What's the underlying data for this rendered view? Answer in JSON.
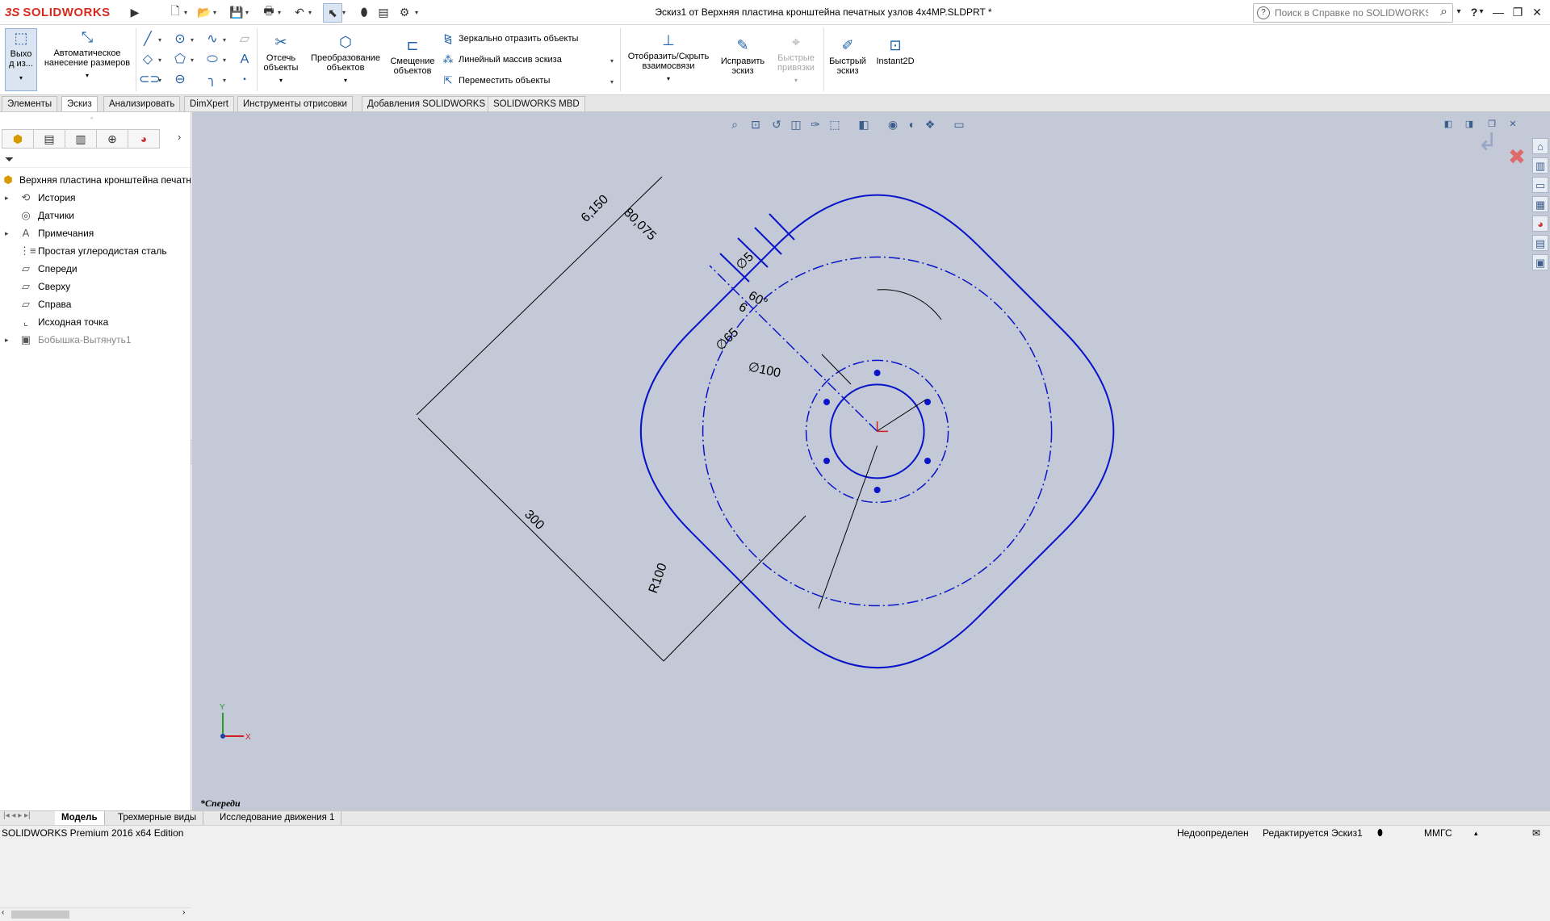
{
  "app": {
    "brand_ds": "3S",
    "brand_name": "SOLIDWORKS"
  },
  "titlebar": {
    "document_title": "Эскиз1 от Верхняя пластина кронштейна печатных узлов 4х4MP.SLDPRT *",
    "help_search_placeholder": "Поиск в Справке по SOLIDWORKS",
    "help_glyph": "?",
    "caret": "▾"
  },
  "command_manager": {
    "exit_sketch": "Выхо\nд из...",
    "smart_dimension": "Автоматическое\nнанесение размеров",
    "trim": "Отсечь\nобъекты",
    "convert": "Преобразование\nобъектов",
    "offset": "Смещение\nобъектов",
    "mirror": "Зеркально отразить объекты",
    "linear_pattern": "Линейный массив эскиза",
    "move": "Переместить объекты",
    "show_relations": "Отобразить/Скрыть\nвзаимосвязи",
    "repair": "Исправить\nэскиз",
    "quick_snaps": "Быстрые\nпривязки",
    "rapid_sketch": "Быстрый\nэскиз",
    "instant2d": "Instant2D"
  },
  "tabs": [
    "Элементы",
    "Эскиз",
    "Анализировать",
    "DimXpert",
    "Инструменты отрисовки",
    "Добавления SOLIDWORKS",
    "SOLIDWORKS MBD"
  ],
  "active_tab_index": 1,
  "feature_tree": {
    "root": "Верхняя пластина кронштейна печатн",
    "items": [
      {
        "label": "История",
        "icon": "history-icon",
        "expandable": true
      },
      {
        "label": "Датчики",
        "icon": "sensors-icon",
        "expandable": false
      },
      {
        "label": "Примечания",
        "icon": "annotations-icon",
        "expandable": true
      },
      {
        "label": "Простая углеродистая сталь",
        "icon": "material-icon",
        "expandable": false
      },
      {
        "label": "Спереди",
        "icon": "plane-icon",
        "expandable": false
      },
      {
        "label": "Сверху",
        "icon": "plane-icon",
        "expandable": false
      },
      {
        "label": "Справа",
        "icon": "plane-icon",
        "expandable": false
      },
      {
        "label": "Исходная точка",
        "icon": "origin-icon",
        "expandable": false
      },
      {
        "label": "Бобышка-Вытянуть1",
        "icon": "extrude-icon",
        "expandable": true,
        "greyed": true
      }
    ]
  },
  "sketch": {
    "dims": [
      "6,150",
      "80,075",
      "∅5",
      "60°",
      "6",
      "∅65",
      "∅100",
      "300",
      "R100"
    ],
    "triad_x": "X",
    "triad_y": "Y",
    "line_color": "#0a14c8"
  },
  "viewport": {
    "view_label": "*Спереди",
    "background": "#c3c9d7"
  },
  "bottom_tabs": [
    "Модель",
    "Трехмерные виды",
    "Исследование движения 1"
  ],
  "status": {
    "edition": "SOLIDWORKS Premium 2016 x64 Edition",
    "state": "Недоопределен",
    "editing": "Редактируется Эскиз1",
    "units": "ММГС",
    "units_caret": "▴"
  }
}
